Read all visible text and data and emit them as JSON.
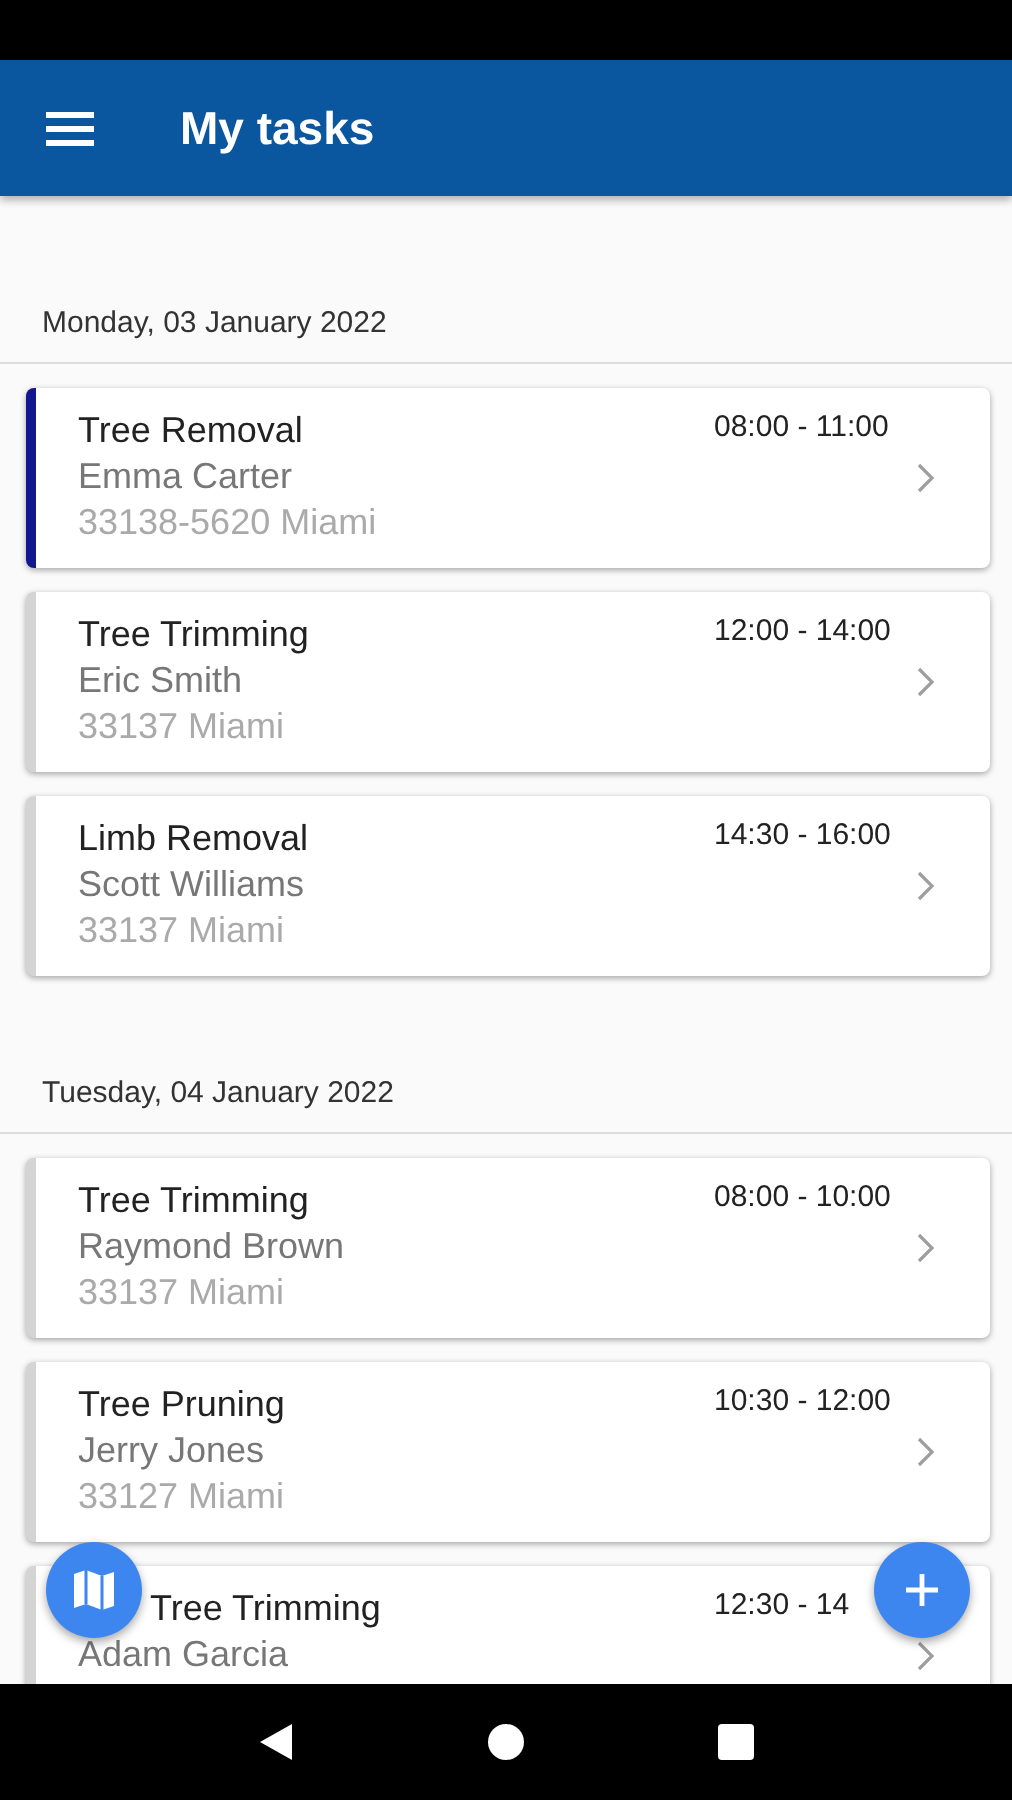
{
  "app_bar": {
    "title": "My tasks"
  },
  "days": [
    {
      "date": "Monday, 03 January 2022",
      "tasks": [
        {
          "title": "Tree Removal",
          "customer": "Emma Carter",
          "address": "33138-5620 Miami",
          "time": "08:00 - 11:00",
          "selected": true
        },
        {
          "title": "Tree Trimming",
          "customer": "Eric Smith",
          "address": "33137 Miami",
          "time": "12:00 - 14:00",
          "selected": false
        },
        {
          "title": "Limb Removal",
          "customer": "Scott Williams",
          "address": "33137 Miami",
          "time": "14:30 - 16:00",
          "selected": false
        }
      ]
    },
    {
      "date": "Tuesday, 04 January 2022",
      "tasks": [
        {
          "title": "Tree Trimming",
          "customer": "Raymond Brown",
          "address": "33137 Miami",
          "time": "08:00 - 10:00",
          "selected": false
        },
        {
          "title": "Tree Pruning",
          "customer": "Jerry Jones",
          "address": "33127 Miami",
          "time": "10:30 - 12:00",
          "selected": false
        },
        {
          "title": "Tree Trimming",
          "customer": "Adam Garcia",
          "time": "12:30 - 14",
          "selected": false,
          "overlapped": true
        }
      ]
    }
  ]
}
